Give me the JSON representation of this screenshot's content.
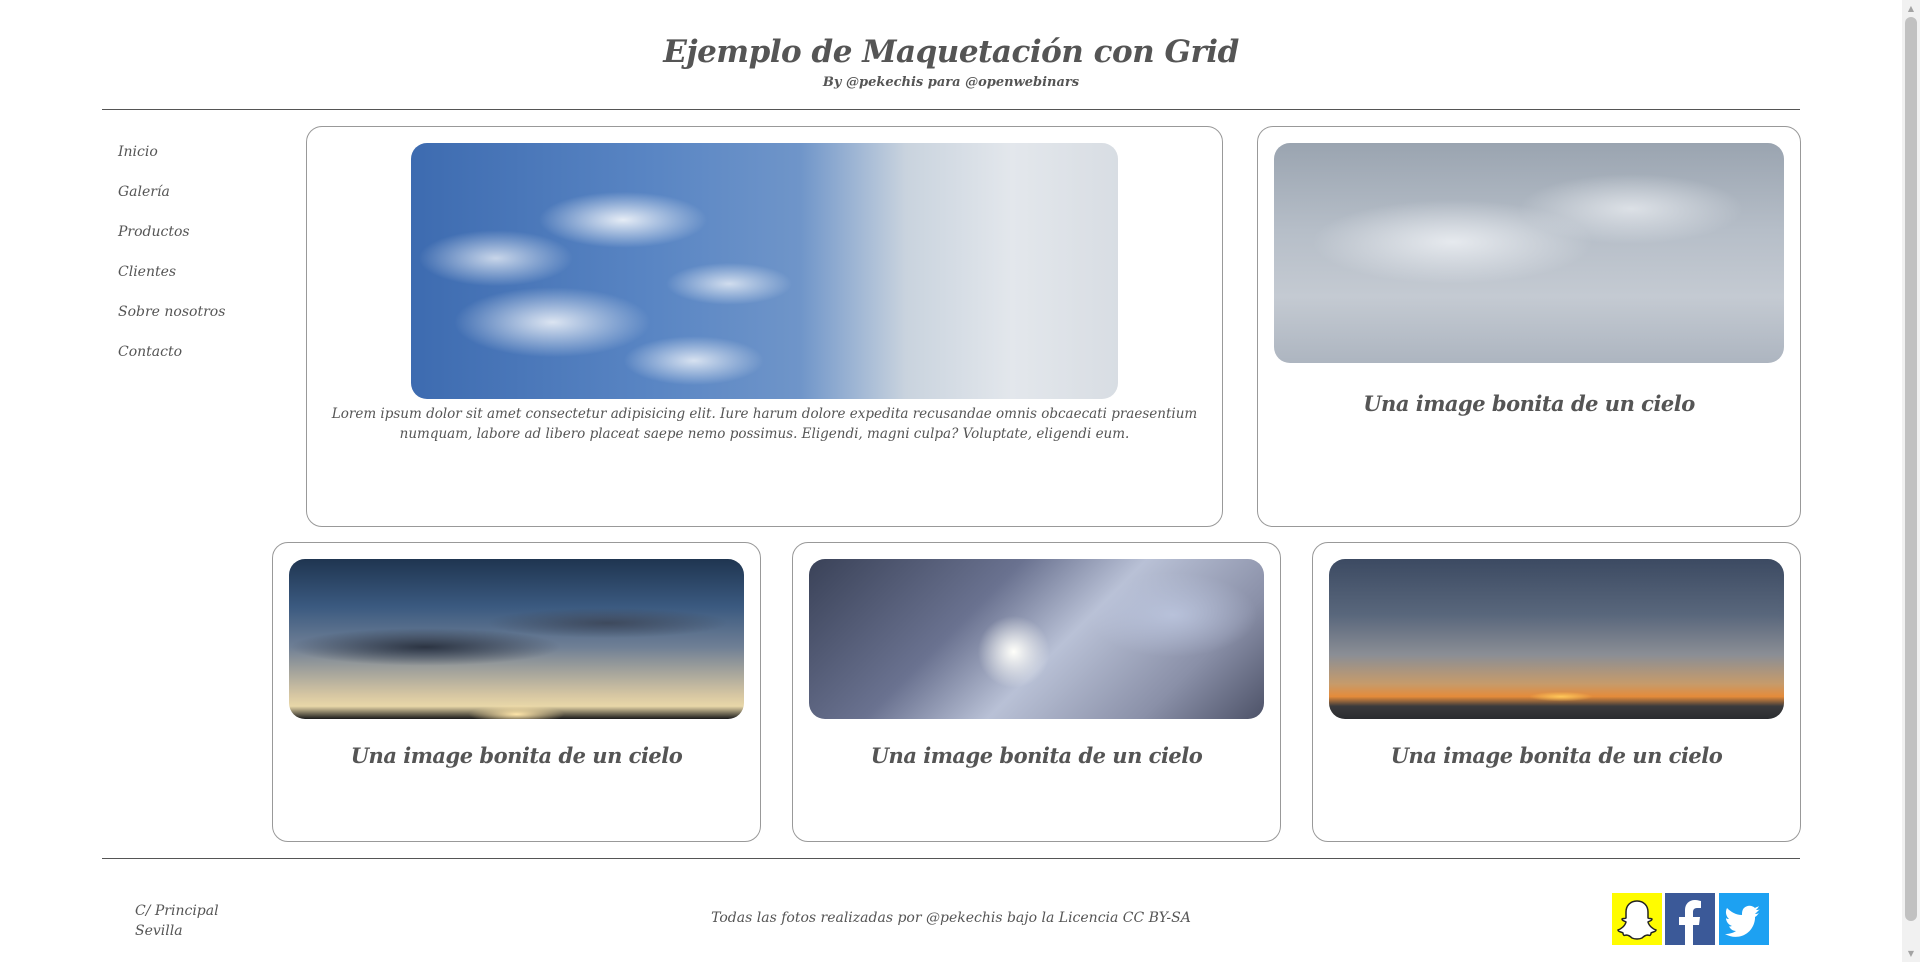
{
  "header": {
    "title": "Ejemplo de Maquetación con Grid",
    "subtitle": "By @pekechis para @openwebinars"
  },
  "nav": {
    "items": [
      {
        "label": "Inicio"
      },
      {
        "label": "Galería"
      },
      {
        "label": "Productos"
      },
      {
        "label": "Clientes"
      },
      {
        "label": "Sobre nosotros"
      },
      {
        "label": "Contacto"
      }
    ]
  },
  "cards": [
    {
      "text": "Lorem ipsum dolor sit amet consectetur adipisicing elit. Iure harum dolore expedita recusandae omnis obcaecati praesentium numquam, labore ad libero placeat saepe nemo possimus. Eligendi, magni culpa? Voluptate, eligendi eum.",
      "image": "blue-sky-clouds-image"
    },
    {
      "caption": "Una image bonita de un cielo",
      "image": "overcast-sky-image"
    },
    {
      "caption": "Una image bonita de un cielo",
      "image": "sunset-clouds-image"
    },
    {
      "caption": "Una image bonita de un cielo",
      "image": "tree-branches-sun-image"
    },
    {
      "caption": "Una image bonita de un cielo",
      "image": "sea-sunset-image"
    }
  ],
  "footer": {
    "address_line1": "C/ Principal",
    "address_line2": "Sevilla",
    "credits": "Todas las fotos realizadas por @pekechis bajo la Licencia CC BY-SA",
    "social": [
      {
        "icon": "snapchat-icon",
        "color": "#fffc00"
      },
      {
        "icon": "facebook-icon",
        "color": "#3b5998"
      },
      {
        "icon": "twitter-icon",
        "color": "#1da1f2"
      }
    ]
  }
}
